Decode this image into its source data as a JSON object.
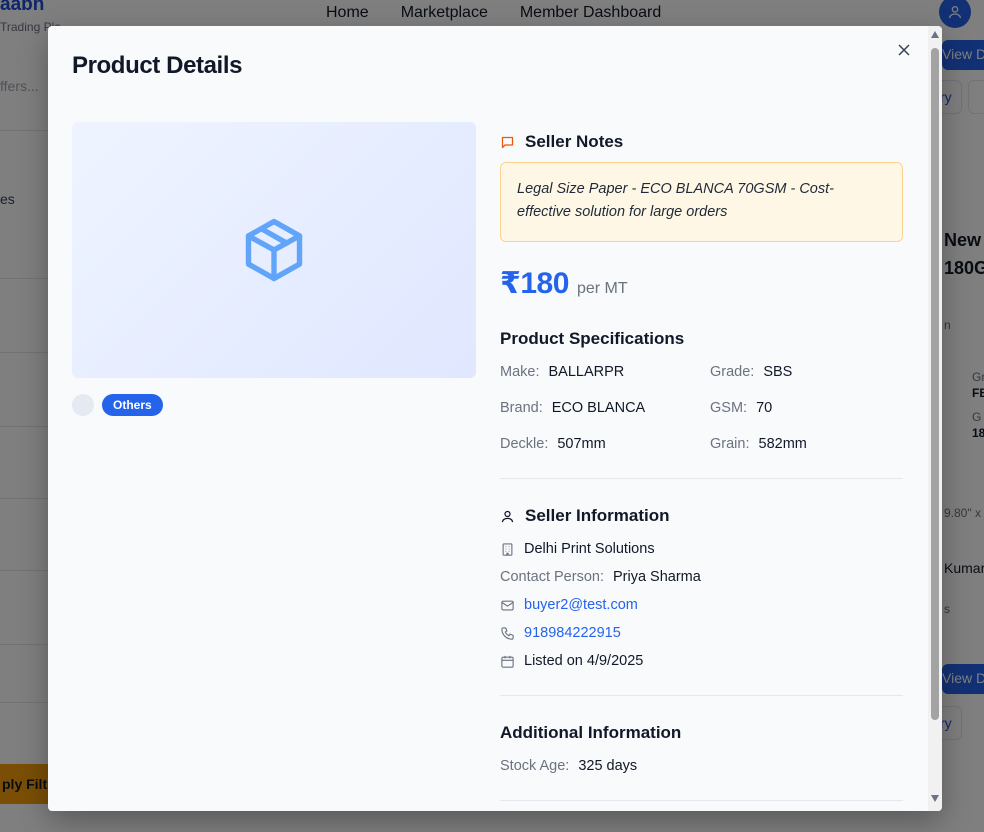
{
  "background": {
    "brand": "aabh",
    "brand_sub": "Trading Pla",
    "nav": [
      "Home",
      "Marketplace",
      "Member Dashboard"
    ],
    "left_search": "ffers...",
    "left_label": "es",
    "apply": "ply Filt",
    "right_view_1": "View D",
    "right_view_2": "View D",
    "right_btn_1": "ry",
    "right_btn_2": "ry",
    "right_title_1": "New",
    "right_title_2": "180G",
    "right_small_1": "n",
    "right_small_2": "Gr",
    "right_small_3": "FB",
    "right_small_4": "G",
    "right_small_5": "18",
    "right_small_6": "9.80\" x",
    "right_small_7": "Kumar",
    "right_small_8": "s"
  },
  "modal": {
    "title": "Product Details",
    "close": "×",
    "category_tag": "Others",
    "seller_notes": {
      "heading": "Seller Notes",
      "text": "Legal Size Paper - ECO BLANCA 70GSM - Cost-effective solution for large orders"
    },
    "price": {
      "amount": "₹180",
      "unit": "per MT"
    },
    "specs": {
      "heading": "Product Specifications",
      "items": [
        {
          "label": "Make:",
          "value": "BALLARPR"
        },
        {
          "label": "Grade:",
          "value": "SBS"
        },
        {
          "label": "Brand:",
          "value": "ECO BLANCA"
        },
        {
          "label": "GSM:",
          "value": "70"
        },
        {
          "label": "Deckle:",
          "value": "507mm"
        },
        {
          "label": "Grain:",
          "value": "582mm"
        }
      ]
    },
    "seller": {
      "heading": "Seller Information",
      "company": "Delhi Print Solutions",
      "contact_label": "Contact Person:",
      "contact_name": "Priya Sharma",
      "email": "buyer2@test.com",
      "phone": "918984222915",
      "listed": "Listed on 4/9/2025"
    },
    "additional": {
      "heading": "Additional Information",
      "stock_age_label": "Stock Age:",
      "stock_age_value": "325 days"
    }
  },
  "colors": {
    "accent": "#2563eb",
    "notes_bg": "#fff7e6",
    "notes_border": "#fcd38d",
    "notes_icon": "#ea580c"
  }
}
